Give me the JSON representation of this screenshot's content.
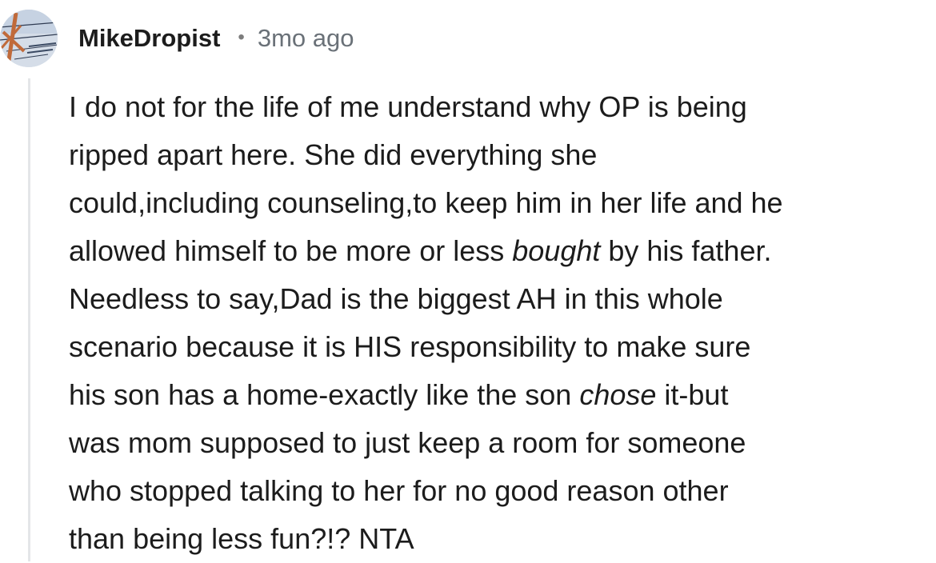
{
  "comment": {
    "author": "MikeDropist",
    "separator": "•",
    "age": "3mo ago",
    "lines": [
      [
        "I do not for the life of me understand why OP is being"
      ],
      [
        "ripped apart here. She did everything she"
      ],
      [
        "could,including counseling,to keep him in her life and he"
      ],
      [
        "allowed himself to be more or less ",
        "bought",
        " by his father."
      ],
      [
        "Needless to say,Dad is the biggest AH in this whole"
      ],
      [
        "scenario because it is HIS responsibility to make sure"
      ],
      [
        "his son has a home-exactly like the son ",
        "chose",
        " it-but"
      ],
      [
        "was mom supposed to just keep a room for someone"
      ],
      [
        "who stopped talking to her for no good reason other"
      ],
      [
        "than being less fun?!? NTA"
      ]
    ]
  },
  "colors": {
    "text": "#1c1c1c",
    "meta": "#6a7178",
    "thread_line": "#e4e6e8"
  }
}
